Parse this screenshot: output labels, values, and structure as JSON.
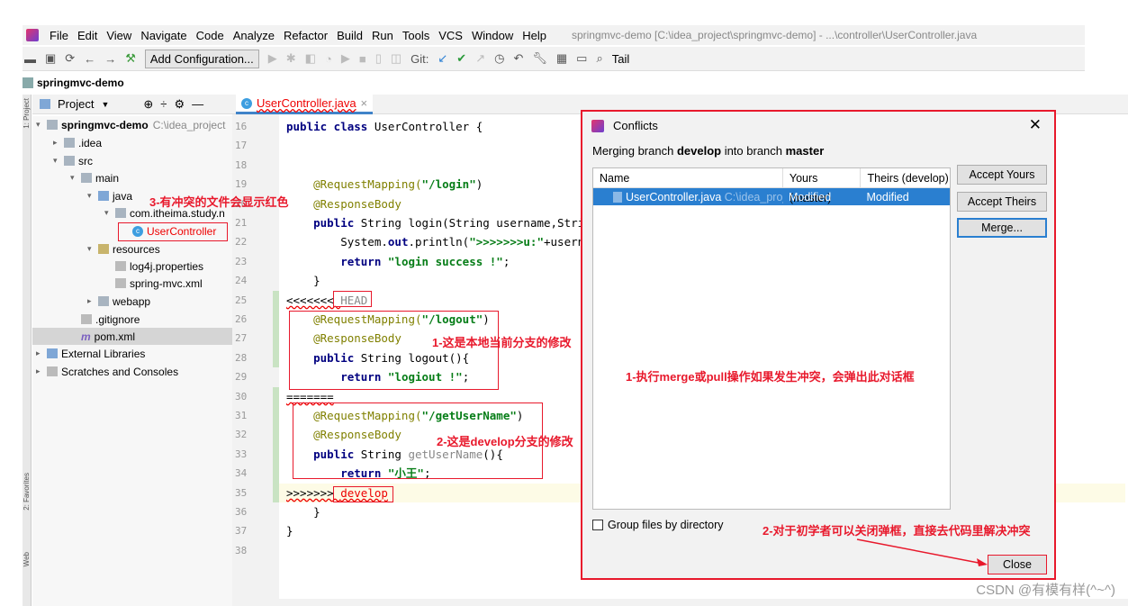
{
  "menu": {
    "items": [
      "File",
      "Edit",
      "View",
      "Navigate",
      "Code",
      "Analyze",
      "Refactor",
      "Build",
      "Run",
      "Tools",
      "VCS",
      "Window",
      "Help"
    ],
    "title": "springmvc-demo [C:\\idea_project\\springmvc-demo] - ...\\controller\\UserController.java"
  },
  "toolbar": {
    "add_config": "Add Configuration...",
    "git": "Git:",
    "tail": "Tail"
  },
  "breadcrumb": "springmvc-demo",
  "project_panel": {
    "label": "Project",
    "tree": [
      {
        "label": "springmvc-demo",
        "extra": "C:\\idea_project",
        "depth": 0,
        "arrow": "▾",
        "icon": "fold",
        "bold": true
      },
      {
        "label": ".idea",
        "depth": 1,
        "arrow": "▸",
        "icon": "fold"
      },
      {
        "label": "src",
        "depth": 1,
        "arrow": "▾",
        "icon": "fold"
      },
      {
        "label": "main",
        "depth": 2,
        "arrow": "▾",
        "icon": "fold"
      },
      {
        "label": "java",
        "depth": 3,
        "arrow": "▾",
        "icon": "src"
      },
      {
        "label": "com.itheima.study.n",
        "depth": 4,
        "arrow": "▾",
        "icon": "fold"
      },
      {
        "label": "UserController",
        "depth": 5,
        "arrow": "",
        "icon": "class",
        "red": true
      },
      {
        "label": "resources",
        "depth": 3,
        "arrow": "▾",
        "icon": "res"
      },
      {
        "label": "log4j.properties",
        "depth": 4,
        "arrow": "",
        "icon": "file"
      },
      {
        "label": "spring-mvc.xml",
        "depth": 4,
        "arrow": "",
        "icon": "file"
      },
      {
        "label": "webapp",
        "depth": 3,
        "arrow": "▸",
        "icon": "fold"
      },
      {
        "label": ".gitignore",
        "depth": 2,
        "arrow": "",
        "icon": "file"
      },
      {
        "label": "pom.xml",
        "depth": 2,
        "arrow": "",
        "icon": "maven",
        "selected": true
      },
      {
        "label": "External Libraries",
        "depth": 0,
        "arrow": "▸",
        "icon": "lib"
      },
      {
        "label": "Scratches and Consoles",
        "depth": 0,
        "arrow": "▸",
        "icon": "scratch"
      }
    ]
  },
  "side_tabs": [
    "1: Project",
    "2: Favorites",
    "Web"
  ],
  "editor": {
    "tab": "UserController.java",
    "lines": [
      {
        "n": "16",
        "seg": [
          [
            "kw",
            "public class "
          ],
          [
            "",
            "UserController {"
          ]
        ]
      },
      {
        "n": "17",
        "seg": []
      },
      {
        "n": "18",
        "seg": []
      },
      {
        "n": "19",
        "seg": [
          [
            "an",
            "    @RequestMapping("
          ],
          [
            "st",
            "\"/login\""
          ],
          [
            "",
            ")"
          ]
        ]
      },
      {
        "n": "20",
        "seg": [
          [
            "an",
            "    @ResponseBody"
          ]
        ]
      },
      {
        "n": "21",
        "seg": [
          [
            "kw",
            "    public "
          ],
          [
            "",
            "String login(String username,Stri"
          ]
        ]
      },
      {
        "n": "22",
        "seg": [
          [
            "",
            "        System."
          ],
          [
            "kw",
            "out"
          ],
          [
            "",
            ".println("
          ],
          [
            "st",
            "\">>>>>>>u:\""
          ],
          [
            "",
            "+usern"
          ]
        ]
      },
      {
        "n": "23",
        "seg": [
          [
            "kw",
            "        return "
          ],
          [
            "st",
            "\"login success !\""
          ],
          [
            "",
            ";"
          ]
        ]
      },
      {
        "n": "24",
        "seg": [
          [
            "",
            "    }"
          ]
        ]
      },
      {
        "n": "25",
        "seg": [
          [
            "mkr",
            "<<<<<<< "
          ],
          [
            "gr",
            "HEAD"
          ]
        ]
      },
      {
        "n": "26",
        "seg": [
          [
            "an",
            "    @RequestMapping("
          ],
          [
            "st",
            "\"/logout\""
          ],
          [
            "",
            ")"
          ]
        ]
      },
      {
        "n": "27",
        "seg": [
          [
            "an",
            "    @ResponseBody"
          ]
        ]
      },
      {
        "n": "28",
        "seg": [
          [
            "kw",
            "    public "
          ],
          [
            "",
            "String logout(){"
          ]
        ]
      },
      {
        "n": "29",
        "seg": [
          [
            "kw",
            "        return "
          ],
          [
            "st",
            "\"logiout !\""
          ],
          [
            "",
            ";"
          ]
        ]
      },
      {
        "n": "30",
        "seg": [
          [
            "mkr",
            "======="
          ]
        ]
      },
      {
        "n": "31",
        "seg": [
          [
            "an",
            "    @RequestMapping("
          ],
          [
            "st",
            "\"/getUserName\""
          ],
          [
            "",
            ")"
          ]
        ]
      },
      {
        "n": "32",
        "seg": [
          [
            "an",
            "    @ResponseBody"
          ]
        ]
      },
      {
        "n": "33",
        "seg": [
          [
            "kw",
            "    public "
          ],
          [
            "",
            "String "
          ],
          [
            "gr",
            "getUserName"
          ],
          [
            "",
            "(){"
          ]
        ]
      },
      {
        "n": "34",
        "seg": [
          [
            "kw",
            "        return "
          ],
          [
            "st",
            "\"小王\""
          ],
          [
            "",
            ";"
          ]
        ]
      },
      {
        "n": "35",
        "seg": [
          [
            "mkr",
            ">>>>>>> "
          ],
          [
            "mkr",
            "develop"
          ]
        ]
      },
      {
        "n": "36",
        "seg": [
          [
            "",
            "    }"
          ]
        ]
      },
      {
        "n": "37",
        "seg": [
          [
            "",
            "}"
          ]
        ]
      },
      {
        "n": "38",
        "seg": []
      }
    ]
  },
  "annotations": {
    "tree_note": "3-有冲突的文件会显示红色",
    "local_note": "1-这是本地当前分支的修改",
    "develop_note": "2-这是develop分支的修改",
    "dialog_note": "1-执行merge或pull操作如果发生冲突，会弹出此对话框",
    "close_note": "2-对于初学者可以关闭弹框，直接去代码里解决冲突"
  },
  "dialog": {
    "title": "Conflicts",
    "msg_pre": "Merging branch ",
    "branch_from": "develop",
    "msg_mid": " into branch ",
    "branch_to": "master",
    "columns": [
      "Name",
      "Yours (master)",
      "Theirs (develop)"
    ],
    "rows": [
      {
        "name": "UserController.java",
        "path": "C:\\idea_proje",
        "yours": "Modified",
        "theirs": "Modified"
      }
    ],
    "buttons": {
      "accept_yours": "Accept Yours",
      "accept_theirs": "Accept Theirs",
      "merge": "Merge...",
      "close": "Close"
    },
    "group_label": "Group files by directory",
    "group_checked": false
  },
  "watermark": "CSDN @有模有样(^~^)",
  "colors": {
    "accent": "#2a7fd0",
    "annotation_red": "#e8192c"
  }
}
